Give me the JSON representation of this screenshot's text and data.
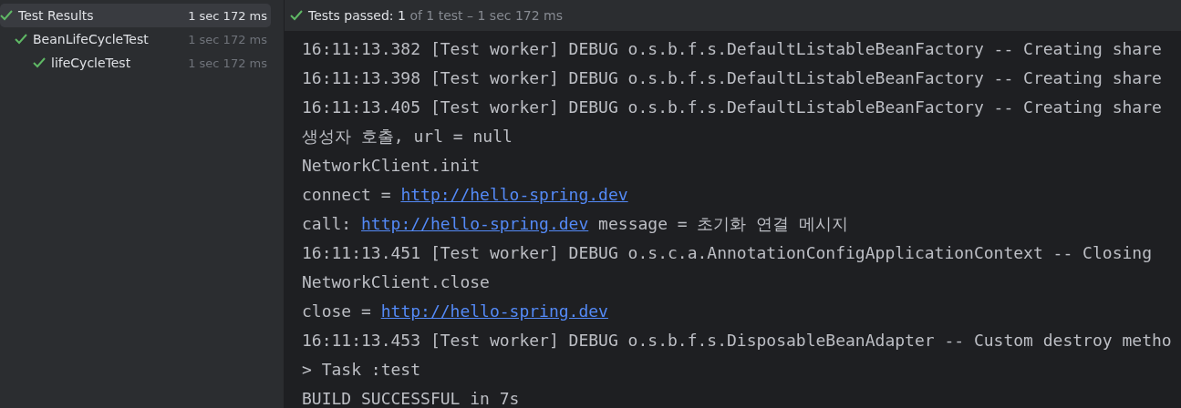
{
  "test_tree": [
    {
      "label": "Test Results",
      "time": "1 sec 172 ms",
      "passed": true,
      "selected": true,
      "children": [
        {
          "label": "BeanLifeCycleTest",
          "time": "1 sec 172 ms",
          "passed": true,
          "selected": false,
          "children": [
            {
              "label": "lifeCycleTest",
              "time": "1 sec 172 ms",
              "passed": true,
              "selected": false
            }
          ]
        }
      ]
    }
  ],
  "status": {
    "passed": true,
    "label": "Tests passed: ",
    "count": "1",
    "detail": " of 1 test – 1 sec 172 ms"
  },
  "console_lines": [
    [
      {
        "kind": "text",
        "text": "16:11:13.382 [Test worker] DEBUG o.s.b.f.s.DefaultListableBeanFactory -- Creating share"
      }
    ],
    [
      {
        "kind": "text",
        "text": "16:11:13.398 [Test worker] DEBUG o.s.b.f.s.DefaultListableBeanFactory -- Creating share"
      }
    ],
    [
      {
        "kind": "text",
        "text": "16:11:13.405 [Test worker] DEBUG o.s.b.f.s.DefaultListableBeanFactory -- Creating share"
      }
    ],
    [
      {
        "kind": "text",
        "text": "생성자 호출, url = null"
      }
    ],
    [
      {
        "kind": "text",
        "text": "NetworkClient.init"
      }
    ],
    [
      {
        "kind": "text",
        "text": "connect = "
      },
      {
        "kind": "link",
        "text": "http://hello-spring.dev"
      }
    ],
    [
      {
        "kind": "text",
        "text": "call: "
      },
      {
        "kind": "link",
        "text": "http://hello-spring.dev"
      },
      {
        "kind": "text",
        "text": " message = 초기화 연결 메시지"
      }
    ],
    [
      {
        "kind": "text",
        "text": "16:11:13.451 [Test worker] DEBUG o.s.c.a.AnnotationConfigApplicationContext -- Closing"
      }
    ],
    [
      {
        "kind": "text",
        "text": "NetworkClient.close"
      }
    ],
    [
      {
        "kind": "text",
        "text": "close = "
      },
      {
        "kind": "link",
        "text": "http://hello-spring.dev"
      }
    ],
    [
      {
        "kind": "text",
        "text": "16:11:13.453 [Test worker] DEBUG o.s.b.f.s.DisposableBeanAdapter -- Custom destroy metho"
      }
    ],
    [
      {
        "kind": "text",
        "text": "> Task :test"
      }
    ],
    [
      {
        "kind": "text",
        "text": "BUILD SUCCESSFUL in 7s"
      }
    ]
  ]
}
